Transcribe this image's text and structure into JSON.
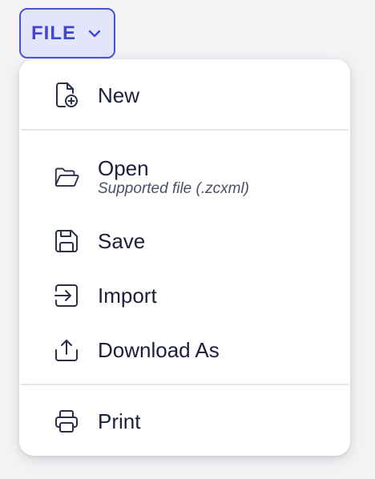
{
  "file_button": {
    "label": "FILE",
    "icon": "chevron-down-icon"
  },
  "menu": {
    "items": [
      {
        "label": "New",
        "icon": "file-plus-icon"
      },
      {
        "label": "Open",
        "sublabel": "Supported file (.zcxml)",
        "icon": "folder-open-icon"
      },
      {
        "label": "Save",
        "icon": "save-icon"
      },
      {
        "label": "Import",
        "icon": "import-icon"
      },
      {
        "label": "Download As",
        "icon": "upload-icon"
      },
      {
        "label": "Print",
        "icon": "printer-icon"
      }
    ]
  },
  "colors": {
    "accent": "#4a54d6",
    "accent_bg": "#e3e6fa",
    "text": "#1c1f3a",
    "icon": "#2b2f4a"
  }
}
